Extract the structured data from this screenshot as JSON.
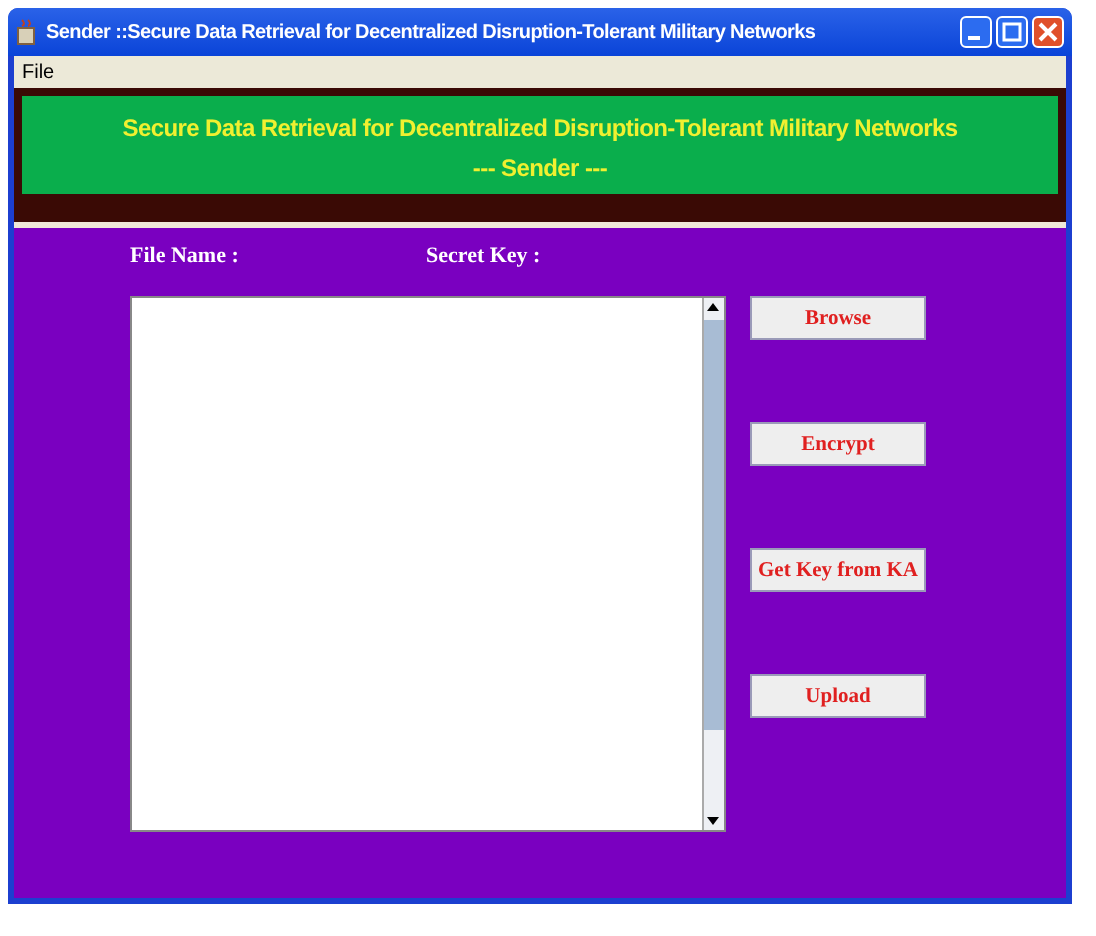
{
  "window": {
    "title": "Sender ::Secure Data Retrieval for Decentralized Disruption-Tolerant Military Networks"
  },
  "menu": [
    "File"
  ],
  "banner": {
    "title": "Secure Data Retrieval for Decentralized Disruption-Tolerant Military Networks",
    "subtitle": "--- Sender ---"
  },
  "labels": [
    "File Name :",
    "Secret Key :"
  ],
  "buttons": [
    "Browse",
    "Encrypt",
    "Get Key from KA",
    "Upload"
  ]
}
